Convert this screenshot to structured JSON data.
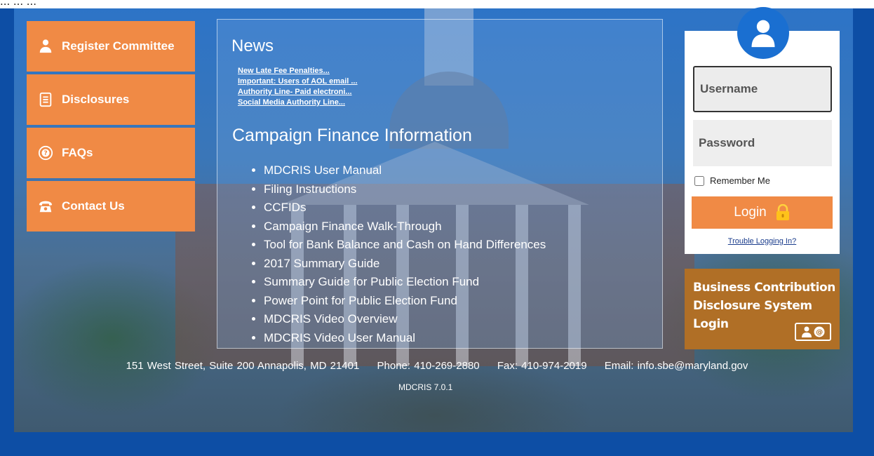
{
  "top_text": "... ... ...",
  "nav": {
    "items": [
      {
        "label": "Register Committee",
        "icon": "user-icon"
      },
      {
        "label": "Disclosures",
        "icon": "document-icon"
      },
      {
        "label": "FAQs",
        "icon": "question-icon"
      },
      {
        "label": "Contact Us",
        "icon": "phone-icon"
      }
    ]
  },
  "news": {
    "title": "News",
    "links": [
      "New Late Fee Penalties...",
      "Important: Users of AOL email ...",
      "Authority Line- Paid electroni...",
      "Social Media Authority Line..."
    ]
  },
  "campaign": {
    "title": "Campaign Finance Information",
    "items": [
      "MDCRIS User Manual",
      "Filing Instructions",
      "CCFIDs",
      "Campaign Finance Walk-Through",
      "Tool for Bank Balance and Cash on Hand Differences",
      "2017 Summary Guide",
      "Summary Guide for Public Election Fund",
      "Power Point for Public Election Fund",
      "MDCRIS Video Overview",
      "MDCRIS Video User Manual"
    ]
  },
  "login": {
    "username_placeholder": "Username",
    "password_placeholder": "Password",
    "remember_label": "Remember Me",
    "button_label": "Login",
    "trouble_link": "Trouble Logging In?"
  },
  "bcd": {
    "line1": "Business Contribution",
    "line2": "Disclosure System",
    "line3": "Login"
  },
  "footer": {
    "address": "151 West Street, Suite 200 Annapolis, MD 21401",
    "phone": "Phone: 410-269-2880",
    "fax": "Fax: 410-974-2019",
    "email": "Email: info.sbe@maryland.gov",
    "version": "MDCRIS 7.0.1"
  },
  "colors": {
    "accent_orange": "#f08a45",
    "page_blue": "#0d4ea5",
    "avatar_blue": "#1a6fd1",
    "bcd_brown": "#b06f26"
  }
}
